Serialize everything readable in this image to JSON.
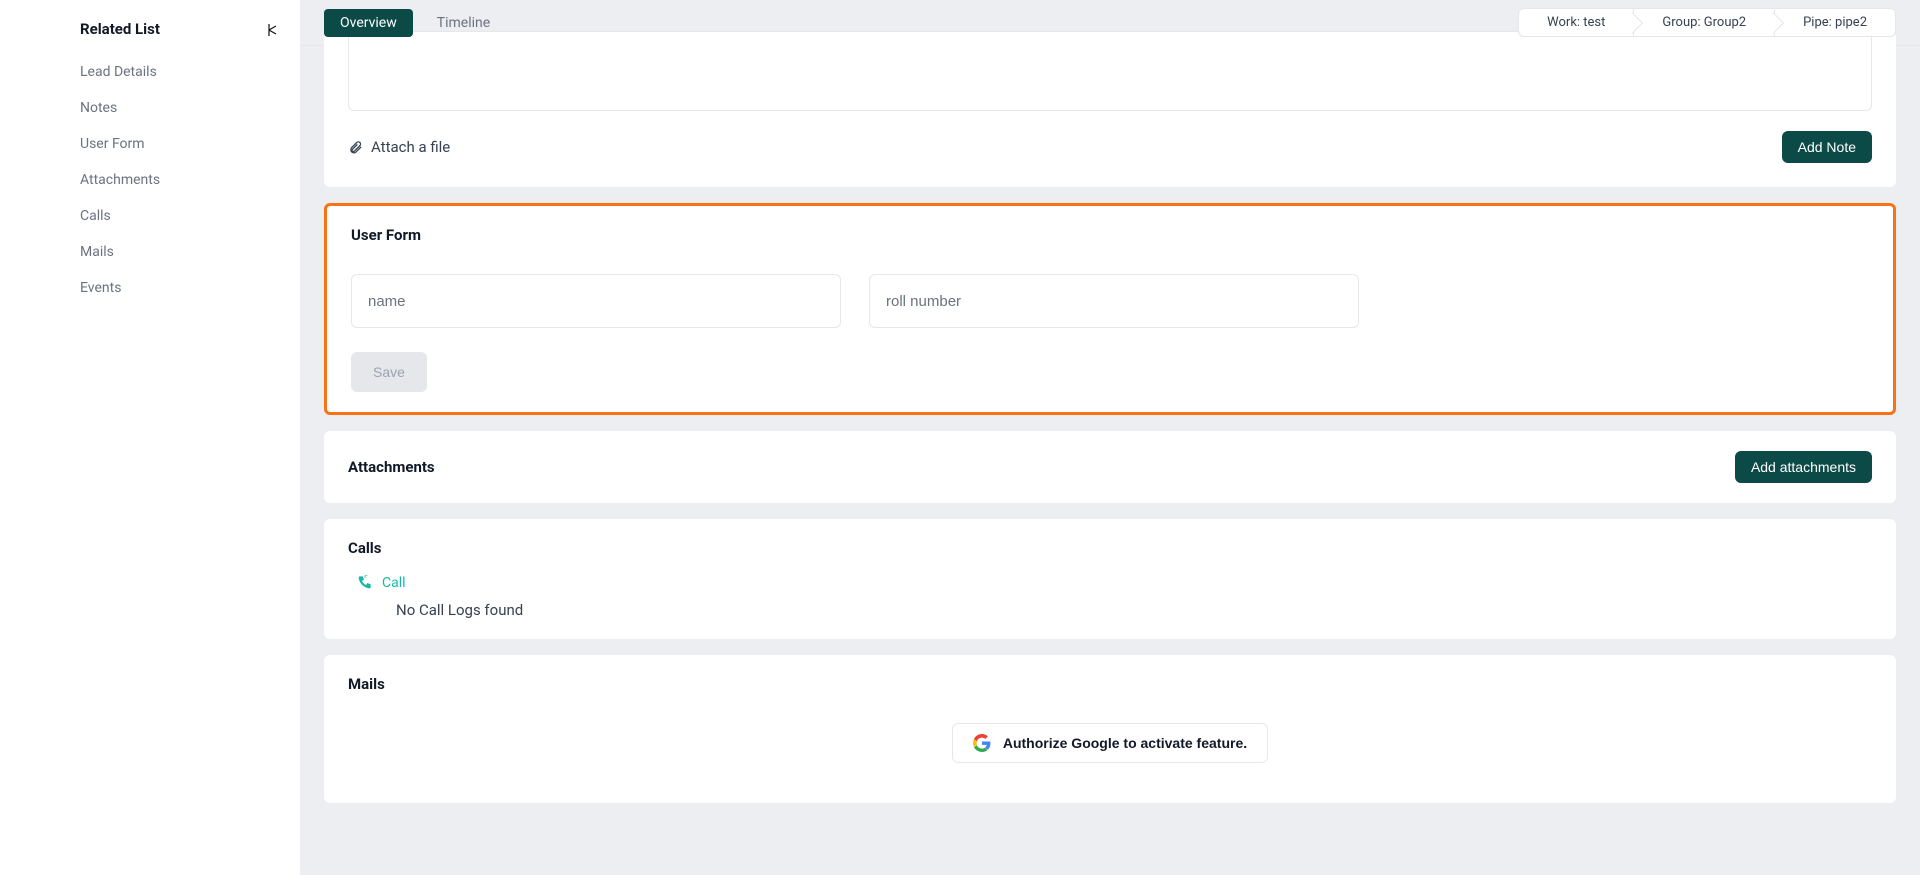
{
  "sidebar": {
    "title": "Related List",
    "items": [
      "Lead Details",
      "Notes",
      "User Form",
      "Attachments",
      "Calls",
      "Mails",
      "Events"
    ]
  },
  "topbar": {
    "tabs": {
      "overview": "Overview",
      "timeline": "Timeline"
    },
    "breadcrumb": {
      "work": "Work: test",
      "group": "Group: Group2",
      "pipe": "Pipe: pipe2"
    }
  },
  "noteSection": {
    "attachLabel": "Attach a file",
    "addButton": "Add Note"
  },
  "userForm": {
    "title": "User Form",
    "namePlaceholder": "name",
    "rollPlaceholder": "roll number",
    "saveLabel": "Save"
  },
  "attachments": {
    "title": "Attachments",
    "addButton": "Add attachments"
  },
  "calls": {
    "title": "Calls",
    "callLabel": "Call",
    "emptyText": "No Call Logs found"
  },
  "mails": {
    "title": "Mails",
    "googleLabel": "Authorize Google to activate feature."
  }
}
